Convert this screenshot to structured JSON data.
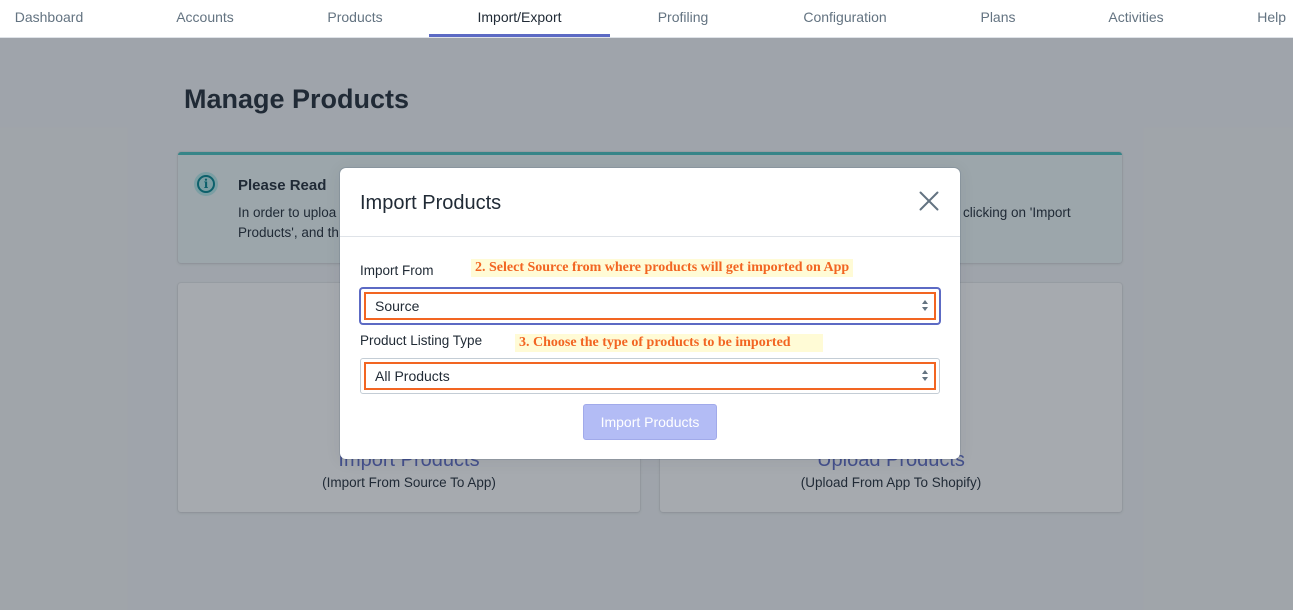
{
  "nav": {
    "items": [
      {
        "label": "Dashboard"
      },
      {
        "label": "Accounts"
      },
      {
        "label": "Products"
      },
      {
        "label": "Import/Export"
      },
      {
        "label": "Profiling"
      },
      {
        "label": "Configuration"
      },
      {
        "label": "Plans"
      },
      {
        "label": "Activities"
      },
      {
        "label": "Help"
      }
    ],
    "active": "Import/Export"
  },
  "page": {
    "title": "Manage Products"
  },
  "banner": {
    "title": "Please Read",
    "text_line1_left": "In order to uploa",
    "text_line2_left": "Products', and th",
    "text_line1_right": "clicking on 'Import"
  },
  "cards": [
    {
      "title": "Import Products",
      "subtitle": "(Import From Source To App)"
    },
    {
      "title": "Upload Products",
      "subtitle": "(Upload From App To Shopify)"
    }
  ],
  "modal": {
    "title": "Import Products",
    "import_from_label": "Import From",
    "import_from_value": "Source",
    "annotation_source": "2. Select Source from where products will get imported on App",
    "listing_type_label": "Product Listing Type",
    "listing_type_value": "All Products",
    "annotation_type": "3. Choose the type of products to be imported",
    "submit_label": "Import Products"
  },
  "colors": {
    "accent": "#5c6ac4",
    "highlight": "#f26522",
    "annotation_bg": "#fffbd6"
  }
}
